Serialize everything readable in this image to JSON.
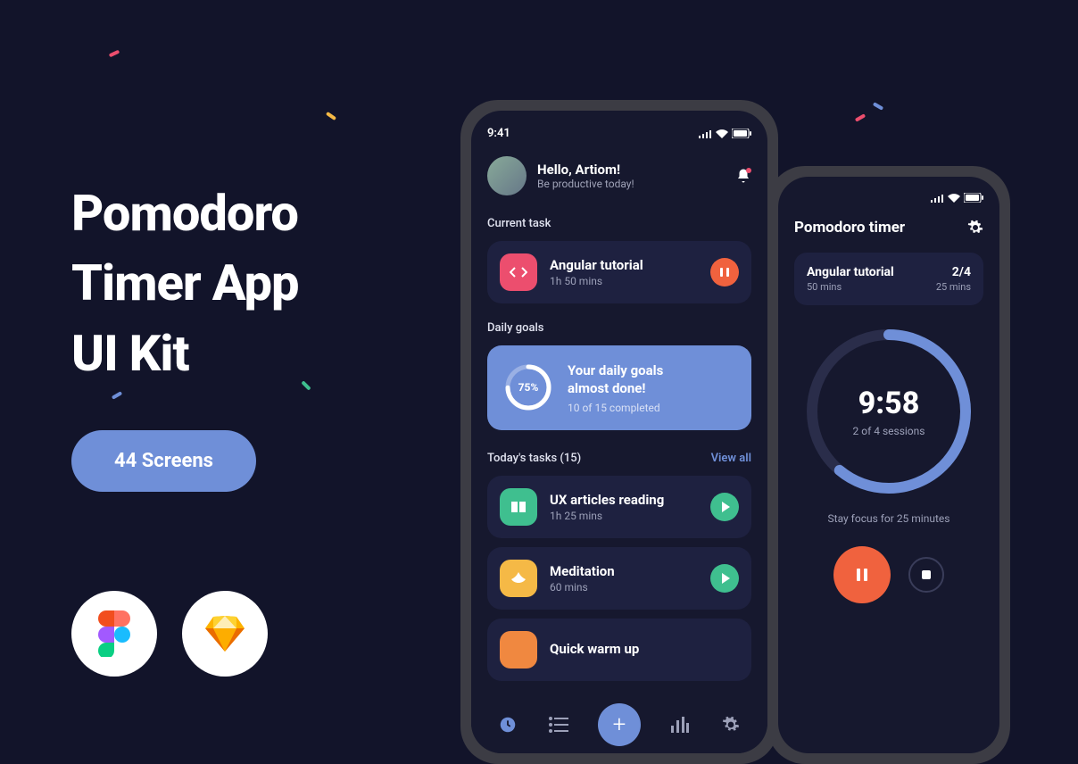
{
  "hero": {
    "title_line1": "Pomodoro",
    "title_line2": "Timer App",
    "title_line3": "UI  Kit",
    "badge": "44 Screens"
  },
  "status": {
    "time": "9:41"
  },
  "header": {
    "greeting": "Hello, Artiom!",
    "subtitle": "Be productive today!"
  },
  "current_task": {
    "label": "Current task",
    "title": "Angular tutorial",
    "duration": "1h 50 mins"
  },
  "goals": {
    "label": "Daily goals",
    "percent": "75%",
    "title_line1": "Your daily goals",
    "title_line2": "almost done!",
    "subtitle": "10 of 15 completed"
  },
  "tasks": {
    "label": "Today's tasks (15)",
    "view_all": "View all",
    "items": [
      {
        "title": "UX articles reading",
        "duration": "1h 25 mins"
      },
      {
        "title": "Meditation",
        "duration": "60 mins"
      },
      {
        "title": "Quick warm up",
        "duration": ""
      }
    ]
  },
  "timer": {
    "title": "Pomodoro timer",
    "task_title": "Angular tutorial",
    "task_sub": "50 mins",
    "count": "2/4",
    "count_dur": "25 mins",
    "time": "9:58",
    "sessions": "2 of 4 sessions",
    "caption": "Stay focus for 25 minutes"
  }
}
